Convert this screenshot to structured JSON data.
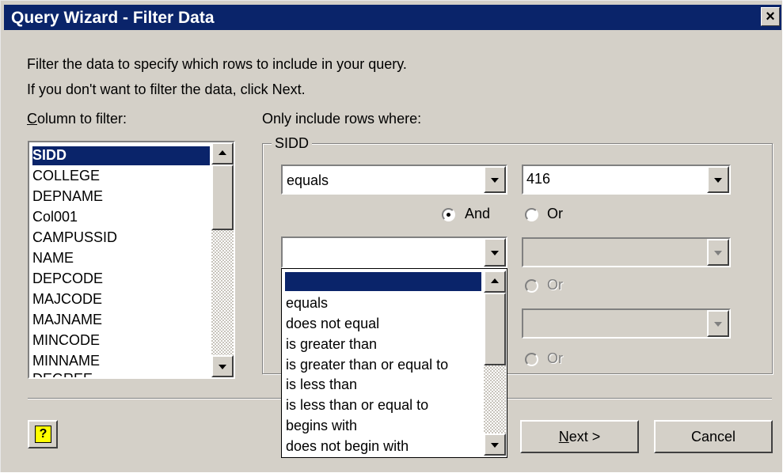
{
  "window": {
    "title": "Query Wizard - Filter Data",
    "close_glyph": "×"
  },
  "intro": {
    "line1": "Filter the data to specify which rows to include in your query.",
    "line2": "If you don't want to filter the data, click Next."
  },
  "columns": {
    "label_accel": "C",
    "label_rest": "olumn to filter:",
    "items": [
      "SIDD",
      "COLLEGE",
      "DEPNAME",
      "Col001",
      "CAMPUSSID",
      "NAME",
      "DEPCODE",
      "MAJCODE",
      "MAJNAME",
      "MINCODE",
      "MINNAME",
      "DEGREE"
    ],
    "selected": "SIDD"
  },
  "filter": {
    "label": "Only include rows where:",
    "group_title": "SIDD",
    "row1": {
      "operator": "equals",
      "value": "416"
    },
    "and_label": "And",
    "or_label": "Or",
    "row2": {
      "operator": "",
      "value": ""
    }
  },
  "operator_dropdown": {
    "options": [
      "",
      "equals",
      "does not equal",
      "is greater than",
      "is greater than or equal to",
      "is less than",
      "is less than or equal to",
      "begins with",
      "does not begin with"
    ]
  },
  "buttons": {
    "help_glyph": "?",
    "next_accel": "N",
    "next_rest": "ext >",
    "cancel": "Cancel"
  }
}
